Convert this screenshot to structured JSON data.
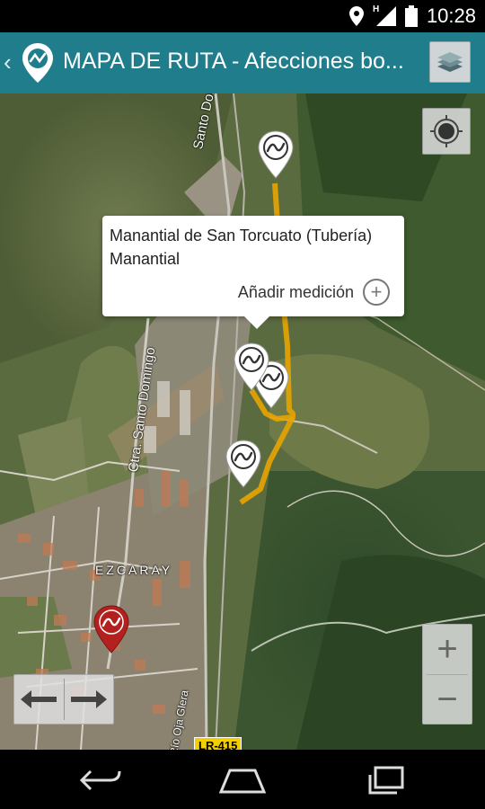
{
  "status_bar": {
    "time": "10:28",
    "network": "H"
  },
  "app_bar": {
    "title": "MAPA DE RUTA - Afecciones bo...",
    "back_icon": "chevron-left-icon",
    "logo_icon": "route-pin-icon",
    "layers_icon": "layers-icon"
  },
  "popup": {
    "title": "Manantial de San Torcuato (Tubería)",
    "type": "Manantial",
    "add_label": "Añadir medición"
  },
  "map": {
    "labels": {
      "road_top": "Santo Domingo",
      "road_left": "Ctra. Santo Domingo",
      "town": "EZCARAY",
      "road_sign": "LR-415",
      "river": "Río Oja Glera"
    },
    "route_color": "#e8a400",
    "marker_color_white": "#ffffff",
    "marker_color_red": "#b3201e"
  },
  "controls": {
    "zoom_in": "+",
    "zoom_out": "−"
  }
}
